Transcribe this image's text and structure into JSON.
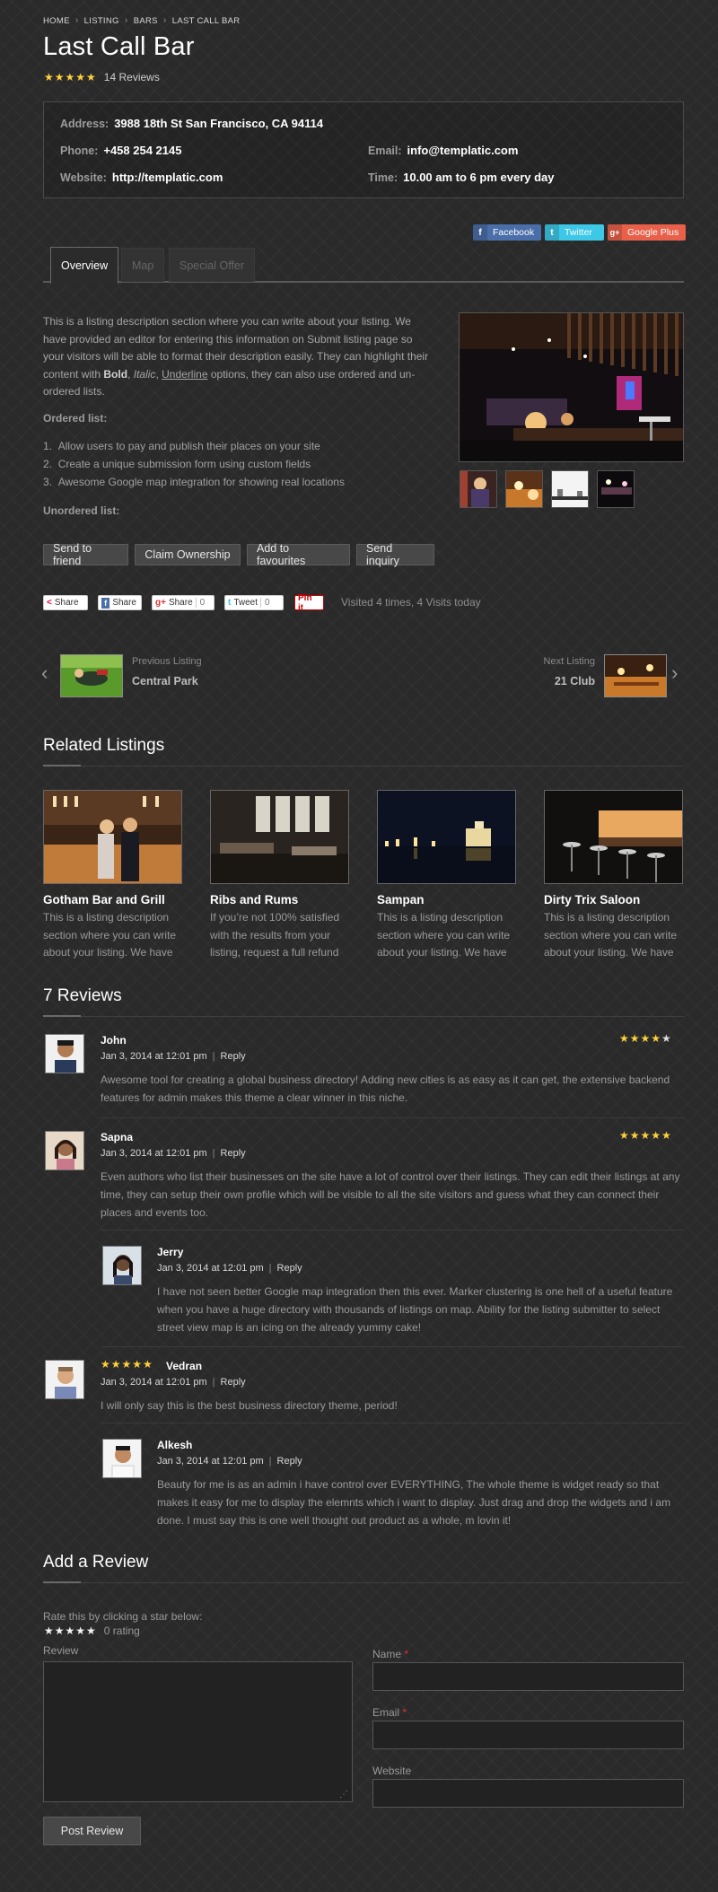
{
  "breadcrumb": [
    "HOME",
    "LISTING",
    "BARS",
    "LAST CALL BAR"
  ],
  "title": "Last Call Bar",
  "reviews_count_label": "14 Reviews",
  "info": {
    "address": {
      "label": "Address:",
      "value": "3988 18th St San Francisco, CA 94114"
    },
    "phone": {
      "label": "Phone:",
      "value": "+458 254 2145"
    },
    "email": {
      "label": "Email:",
      "value": "info@templatic.com"
    },
    "website": {
      "label": "Website:",
      "value": "http://templatic.com"
    },
    "time": {
      "label": "Time:",
      "value": "10.00 am to 6 pm every day"
    }
  },
  "social": {
    "facebook": "Facebook",
    "twitter": "Twitter",
    "google": "Google Plus"
  },
  "tabs": [
    "Overview",
    "Map",
    "Special Offer"
  ],
  "description": {
    "p1": "This is a listing description section where you can write about your listing. We have provided an editor for entering this information on Submit listing page so your visitors will be able to format their description easily. They can highlight their content with",
    "bold": "Bold",
    "comma1": ",",
    "italic": "Italic",
    "comma2": ",",
    "underline": "Underline",
    "p2": "options, they can also use ordered and un-ordered lists.",
    "ordered_heading": "Ordered list:",
    "ordered": [
      "Allow users to pay and publish their places on your site",
      "Create a unique submission form using custom fields",
      "Awesome Google map integration for showing real locations"
    ],
    "unordered_heading": "Unordered list:"
  },
  "buttons": [
    "Send to friend",
    "Claim Ownership",
    "Add to favourites",
    "Send inquiry"
  ],
  "share": {
    "fb": "Share",
    "fb2": "Share",
    "gplus": "Share",
    "gplus_count": "0",
    "tweet": "Tweet",
    "tweet_count": "0",
    "pin": "Pin it"
  },
  "visits": "Visited 4 times, 4 Visits today",
  "prev": {
    "label": "Previous Listing",
    "title": "Central Park"
  },
  "next": {
    "label": "Next Listing",
    "title": "21 Club"
  },
  "related_heading": "Related Listings",
  "related": [
    {
      "title": "Gotham Bar and Grill",
      "excerpt": "This is a listing description section where you can write about your listing. We have"
    },
    {
      "title": "Ribs and Rums",
      "excerpt": "If you’re not 100% satisfied with the results from your listing, request a full refund"
    },
    {
      "title": "Sampan",
      "excerpt": "This is a listing description section where you can write about your listing. We have"
    },
    {
      "title": "Dirty Trix Saloon",
      "excerpt": "This is a listing description section where you can write about your listing. We have"
    }
  ],
  "reviews_heading": "7 Reviews",
  "reply": "Reply",
  "reviews": [
    {
      "name": "John",
      "date": "Jan 3, 2014 at 12:01 pm",
      "text": "Awesome tool for creating a global business directory! Adding new cities is as easy as it can get, the extensive backend features for admin makes this theme a clear winner in this niche.",
      "rating": 4
    },
    {
      "name": "Sapna",
      "date": "Jan 3, 2014 at 12:01 pm",
      "text": "Even authors who list their businesses on the site have a lot of control over their listings. They can edit their listings at any time, they can setup their own profile which will be visible to all the site visitors and guess what they can connect their places and events too.",
      "rating": 5
    },
    {
      "name": "Jerry",
      "date": "Jan 3, 2014 at 12:01 pm",
      "text": "I have not seen better Google map integration then this ever. Marker clustering is one hell of a useful feature when you have a huge directory with thousands of listings on map. Ability for the listing submitter to select street view map is an icing on the already yummy cake!"
    },
    {
      "name": "Vedran",
      "date": "Jan 3, 2014 at 12:01 pm",
      "text": "I will only say this is the best business directory theme, period!",
      "rating": 5
    },
    {
      "name": "Alkesh",
      "date": "Jan 3, 2014 at 12:01 pm",
      "text": "Beauty for me is as an admin i have control over EVERYTHING, The whole theme is widget ready so that makes it easy for me to display the elemnts which i want to display. Just drag and drop the widgets and i am done. I must say this is one well thought out product as a whole, m lovin it!"
    }
  ],
  "add_review": {
    "heading": "Add a Review",
    "rate_hint": "Rate this by clicking a star below:",
    "rating_text": "0 rating",
    "review_label": "Review",
    "name_label": "Name",
    "email_label": "Email",
    "website_label": "Website",
    "required_mark": "*",
    "submit": "Post Review"
  },
  "colors": {
    "facebook": "#4a6ea9",
    "twitter": "#3cc8e6",
    "google": "#e8604a",
    "star": "#ffd23c"
  }
}
